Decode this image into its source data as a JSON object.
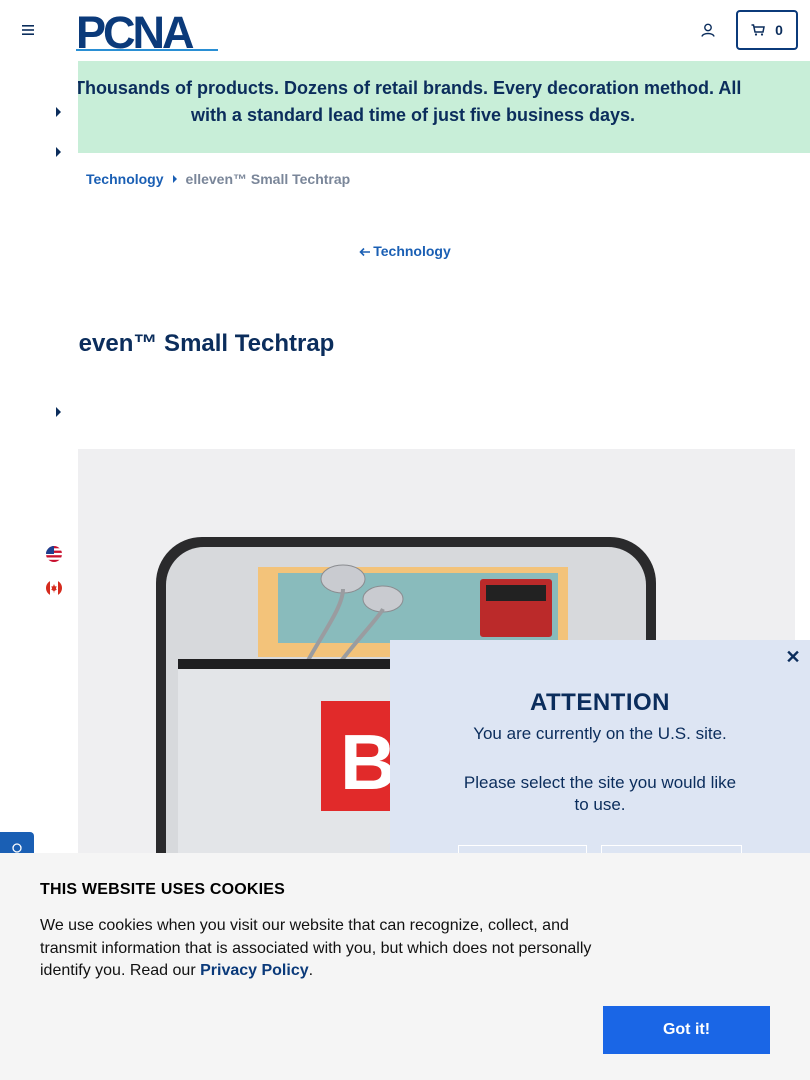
{
  "header": {
    "logo_text": "PCNA",
    "cart_count": "0"
  },
  "banner": {
    "line1": "Wait? Thousands of products. Dozens of retail brands. Every decoration method. All",
    "line2": "with a standard lead time of just five business days."
  },
  "breadcrumb": {
    "parent": "Technology",
    "current": "elleven™ Small Techtrap"
  },
  "back_link": {
    "label": "Technology"
  },
  "product": {
    "title": "elleven™ Small Techtrap"
  },
  "attention": {
    "title": "ATTENTION",
    "message": "You are currently on the U.S. site.",
    "prompt": "Please select the site you would like to use."
  },
  "cookie": {
    "title": "THIS WEBSITE USES COOKIES",
    "body": "We use cookies when you visit our website that can recognize, collect, and transmit information that is associated with you, but which does not personally identify you. Read our ",
    "link": "Privacy Policy",
    "period": ".",
    "accept": "Got it!"
  },
  "colors": {
    "navy": "#0b2d5c",
    "link_blue": "#1a5fb4",
    "banner_green": "#c8eed8",
    "modal_bg": "#dde5f3",
    "cookie_button": "#1a66e6"
  }
}
